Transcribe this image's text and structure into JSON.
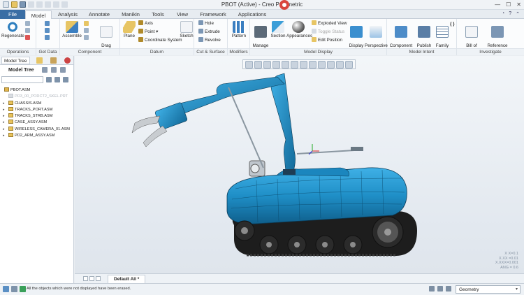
{
  "window": {
    "title": "PBOT (Active) - Creo Parametric"
  },
  "tabs": [
    "File",
    "Model",
    "Analysis",
    "Annotate",
    "Manikin",
    "Tools",
    "View",
    "Framework",
    "Applications"
  ],
  "ribbon": {
    "operations": {
      "label": "Operations",
      "regenerate": "Regenerate"
    },
    "get_data": {
      "label": "Get Data"
    },
    "component": {
      "label": "Component",
      "assemble": "Assemble",
      "drag": "Drag\nComponents"
    },
    "datum": {
      "label": "Datum",
      "plane": "Plane",
      "axis": "Axis",
      "point": "Point",
      "coord": "Coordinate System",
      "sketch": "Sketch"
    },
    "cut_surface": {
      "label": "Cut & Surface",
      "hole": "Hole",
      "extrude": "Extrude",
      "revolve": "Revolve"
    },
    "modifiers": {
      "label": "Modifiers",
      "pattern": "Pattern"
    },
    "model_display": {
      "label": "Model Display",
      "manage_views": "Manage\nViews",
      "section": "Section",
      "appearances": "Appearances",
      "exploded": "Exploded View",
      "toggle_status": "Toggle Status",
      "edit_position": "Edit Position",
      "display_style": "Display\nStyle",
      "perspective": "Perspective\nView"
    },
    "model_intent": {
      "label": "Model Intent",
      "component_interface": "Component\nInterface",
      "publish_geometry": "Publish\nGeometry",
      "family_table": "Family\nTable"
    },
    "investigate": {
      "label": "Investigate",
      "bom": "Bill of\nMaterials",
      "reference_viewer": "Reference\nViewer"
    }
  },
  "left": {
    "tab_label": "Model Tree",
    "tree_title": "Model Tree",
    "items": [
      {
        "label": "PBOT.ASM",
        "root": true,
        "dim": false
      },
      {
        "label": "PD3_00_PORCT2_SKEL.PRT",
        "root": false,
        "dim": true
      },
      {
        "label": "CHASSIS.ASM",
        "root": false,
        "dim": false
      },
      {
        "label": "TRACKS_PORT.ASM",
        "root": false,
        "dim": false
      },
      {
        "label": "TRACKS_STRB.ASM",
        "root": false,
        "dim": false
      },
      {
        "label": "CASE_ASSY.ASM",
        "root": false,
        "dim": false
      },
      {
        "label": "WIRELESS_CAMERA_01.ASM",
        "root": false,
        "dim": false
      },
      {
        "label": "PD2_ARM_ASSY.ASM",
        "root": false,
        "dim": false
      }
    ]
  },
  "viewport": {
    "coords": [
      "X X=0.1",
      "X.XX =0.01",
      "X.XXX=0.001",
      "ANG = 0.6"
    ]
  },
  "model_tab": {
    "label": "Default All *"
  },
  "status": {
    "message": "All the objects which were not displayed have been erased.",
    "filter": "Geometry"
  },
  "colors": {
    "model_blue": "#1f8fc7",
    "file_tab": "#3a6ea5"
  }
}
